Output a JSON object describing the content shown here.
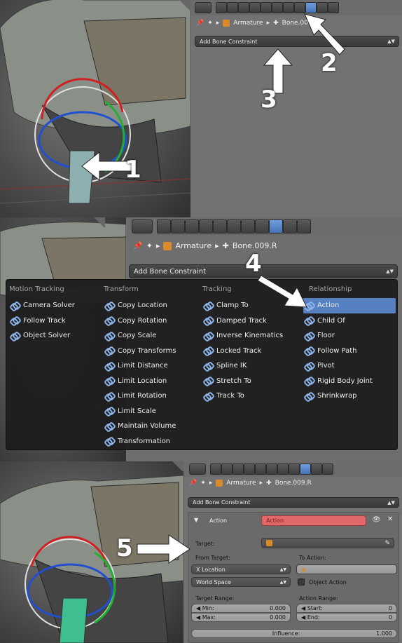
{
  "panel1": {
    "breadcrumb": {
      "object": "Armature",
      "bone": "Bone.009.R"
    },
    "dropdown_label": "Add Bone Constraint",
    "step_numbers": [
      "1",
      "2",
      "3"
    ]
  },
  "panel2": {
    "breadcrumb": {
      "object": "Armature",
      "bone": "Bone.009.R"
    },
    "dropdown_label": "Add Bone Constraint",
    "step_number": "4",
    "menu": {
      "columns": [
        {
          "heading": "Motion Tracking",
          "items": [
            "Camera Solver",
            "Follow Track",
            "Object Solver"
          ]
        },
        {
          "heading": "Transform",
          "items": [
            "Copy Location",
            "Copy Rotation",
            "Copy Scale",
            "Copy Transforms",
            "Limit Distance",
            "Limit Location",
            "Limit Rotation",
            "Limit Scale",
            "Maintain Volume",
            "Transformation"
          ]
        },
        {
          "heading": "Tracking",
          "items": [
            "Clamp To",
            "Damped Track",
            "Inverse Kinematics",
            "Locked Track",
            "Spline IK",
            "Stretch To",
            "Track To"
          ]
        },
        {
          "heading": "Relationship",
          "items": [
            "Action",
            "Child Of",
            "Floor",
            "Follow Path",
            "Pivot",
            "Rigid Body Joint",
            "Shrinkwrap"
          ]
        }
      ],
      "highlighted": "Action"
    }
  },
  "panel3": {
    "breadcrumb": {
      "object": "Armature",
      "bone": "Bone.009.R"
    },
    "dropdown_label": "Add Bone Constraint",
    "step_number": "5",
    "constraint": {
      "type_label": "Action",
      "name_value": "Action",
      "target_label": "Target:",
      "from_target_label": "From Target:",
      "to_action_label": "To Action:",
      "transform_channel": "X Location",
      "target_space": "World Space",
      "object_action_label": "Object Action",
      "target_range_label": "Target Range:",
      "action_range_label": "Action Range:",
      "min_label": "Min:",
      "min_value": "0.000",
      "max_label": "Max:",
      "max_value": "0.000",
      "start_label": "Start:",
      "start_value": "0",
      "end_label": "End:",
      "end_value": "0",
      "influence_label": "Influence:",
      "influence_value": "1.000"
    }
  },
  "colors": {
    "selected_tab": "#5680c2",
    "action_field": "#e0676a",
    "menu_bg": "#1c1c1c",
    "properties_bg": "#727272"
  }
}
